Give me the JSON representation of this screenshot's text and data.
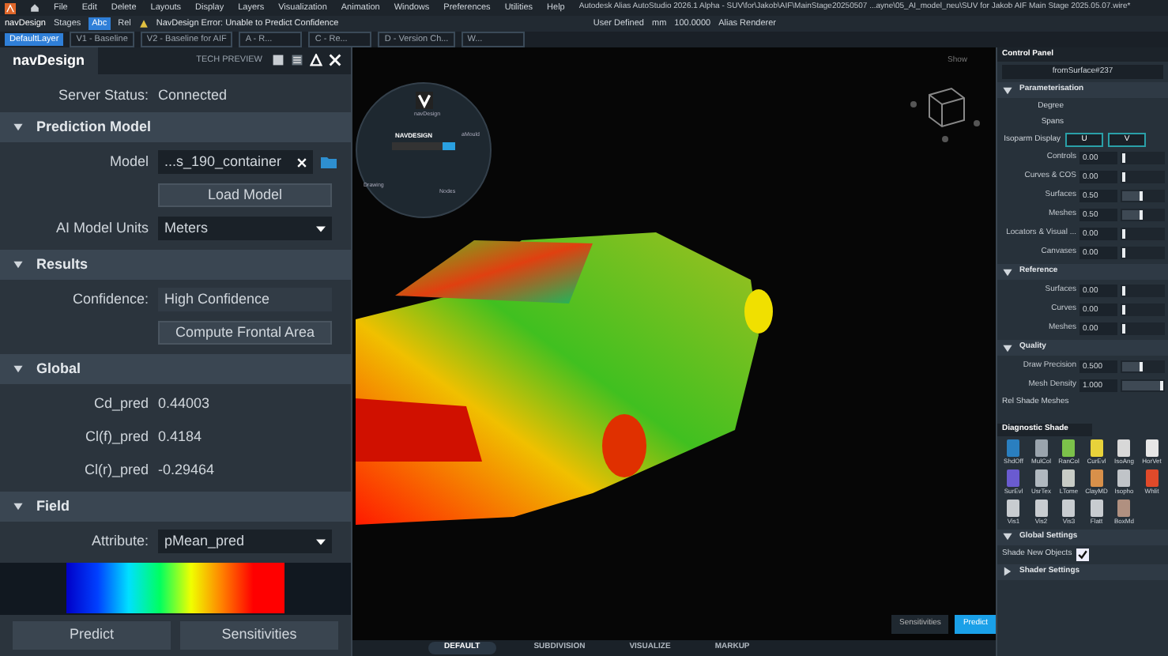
{
  "menu_bar": {
    "items": [
      "File",
      "Edit",
      "Delete",
      "Layouts",
      "Display",
      "Layers",
      "Visualization",
      "Animation",
      "Windows",
      "Preferences",
      "Utilities",
      "Help"
    ],
    "title": "Autodesk Alias AutoStudio 2026.1 Alpha - SUV\\for\\Jakob\\AIF\\MainStage20250507 ...ayne\\05_AI_model_neu\\SUV for Jakob AIF Main Stage 2025.05.07.wire*"
  },
  "toolbar": {
    "app": "navDesign",
    "stages": "Stages",
    "abc": "Abc",
    "rel": "Rel",
    "message": "NavDesign Error: Unable to Predict Confidence",
    "mode": "User Defined",
    "units": "mm",
    "scale": "100.0000",
    "renderer": "Alias Renderer"
  },
  "layers": [
    {
      "label": "DefaultLayer",
      "selected": true
    },
    {
      "label": "V1 - Baseline",
      "selected": false
    },
    {
      "label": "V2 - Baseline for AIF",
      "selected": false
    },
    {
      "label": "A - R...",
      "selected": false
    },
    {
      "label": "C - Re...",
      "selected": false
    },
    {
      "label": "D - Version Ch...",
      "selected": false
    },
    {
      "label": "W...",
      "selected": false
    }
  ],
  "nav_panel": {
    "title": "navDesign",
    "badge": "TECH PREVIEW",
    "server_label": "Server Status:",
    "server_value": "Connected",
    "sections": [
      {
        "title": "Prediction Model",
        "expanded": true,
        "model_label": "Model",
        "model_value": "...s_190_container",
        "load": "Load Model",
        "units_label": "AI Model Units",
        "units_value": "Meters"
      },
      {
        "title": "Results",
        "expanded": true,
        "confidence_label": "Confidence:",
        "confidence_value": "High Confidence",
        "compute": "Compute Frontal Area"
      },
      {
        "title": "Global",
        "expanded": true,
        "rows": [
          {
            "label": "Cd_pred",
            "value": "0.44003"
          },
          {
            "label": "Cl(f)_pred",
            "value": "0.4184"
          },
          {
            "label": "Cl(r)_pred",
            "value": "-0.29464"
          }
        ]
      },
      {
        "title": "Field",
        "expanded": true,
        "attribute_label": "Attribute:",
        "attribute_value": "pMean_pred"
      }
    ],
    "buttons": [
      "Predict",
      "Sensitivities"
    ]
  },
  "viewport": {
    "show": "Show",
    "radial": {
      "center_title": "NAVDESIGN",
      "top": "navDesign",
      "right": "aMould",
      "left": "Drawing",
      "bottom": "Nodes"
    },
    "buttons": [
      {
        "label": "Sensitivities",
        "selected": false
      },
      {
        "label": "Predict",
        "selected": true
      }
    ]
  },
  "bottom_tabs": [
    {
      "label": "DEFAULT",
      "selected": true
    },
    {
      "label": "SUBDIVISION",
      "selected": false
    },
    {
      "label": "VISUALIZE",
      "selected": false
    },
    {
      "label": "MARKUP",
      "selected": false
    }
  ],
  "control_panel": {
    "title": "Control Panel",
    "object": "fromSurface#237",
    "parameterisation": {
      "title": "Parameterisation",
      "expanded": true,
      "labels": [
        "Degree",
        "Spans"
      ],
      "isoparm_label": "Isoparm Display",
      "isoparm_buttons": [
        "U",
        "V"
      ],
      "sliders": [
        {
          "label": "Controls",
          "value": "0.00",
          "level": 0.0
        },
        {
          "label": "Curves & COS",
          "value": "0.00",
          "level": 0.0
        },
        {
          "label": "Surfaces",
          "value": "0.50",
          "level": 0.5
        },
        {
          "label": "Meshes",
          "value": "0.50",
          "level": 0.5
        },
        {
          "label": "Locators & Visual ...",
          "value": "0.00",
          "level": 0.0
        },
        {
          "label": "Canvases",
          "value": "0.00",
          "level": 0.0
        }
      ]
    },
    "reference": {
      "title": "Reference",
      "expanded": true,
      "sliders": [
        {
          "label": "Surfaces",
          "value": "0.00",
          "level": 0.0
        },
        {
          "label": "Curves",
          "value": "0.00",
          "level": 0.0
        },
        {
          "label": "Meshes",
          "value": "0.00",
          "level": 0.0
        }
      ]
    },
    "quality": {
      "title": "Quality",
      "expanded": true,
      "sliders": [
        {
          "label": "Draw Precision",
          "value": "0.500",
          "level": 0.5
        },
        {
          "label": "Mesh Density",
          "value": "1.000",
          "level": 1.0
        }
      ],
      "cut_label": "Rel Shade Meshes"
    },
    "diagnostic": {
      "title": "Diagnostic Shade",
      "shaders": [
        {
          "label": "ShdOff",
          "color": "#2a7fc0"
        },
        {
          "label": "MulCol",
          "color": "#9aa4ad"
        },
        {
          "label": "RanCol",
          "color": "#7cc24a"
        },
        {
          "label": "CurEvl",
          "color": "#e8d23a"
        },
        {
          "label": "IsoAng",
          "color": "#d8d8d8"
        },
        {
          "label": "HorVet",
          "color": "#e6e6e6"
        },
        {
          "label": "SurEvl",
          "color": "#6a5bd0"
        },
        {
          "label": "UsrTex",
          "color": "#b0b8bf"
        },
        {
          "label": "LTome",
          "color": "#c8ccc6"
        },
        {
          "label": "ClayMD",
          "color": "#d8904a"
        },
        {
          "label": "Isopho",
          "color": "#c0c4c8"
        },
        {
          "label": "Whlit",
          "color": "#e04a2a"
        },
        {
          "label": "Vis1",
          "color": "#c8ccd0"
        },
        {
          "label": "Vis2",
          "color": "#c8ccd0"
        },
        {
          "label": "Vis3",
          "color": "#c8ccd0"
        },
        {
          "label": "Flatt",
          "color": "#c8ccd0"
        },
        {
          "label": "BoxMd",
          "color": "#b09080"
        }
      ]
    },
    "global": {
      "title": "Global Settings",
      "expanded": true,
      "shade_label": "Shade New Objects",
      "shade_checked": true
    },
    "shader_settings": {
      "title": "Shader Settings",
      "expanded": false
    }
  }
}
